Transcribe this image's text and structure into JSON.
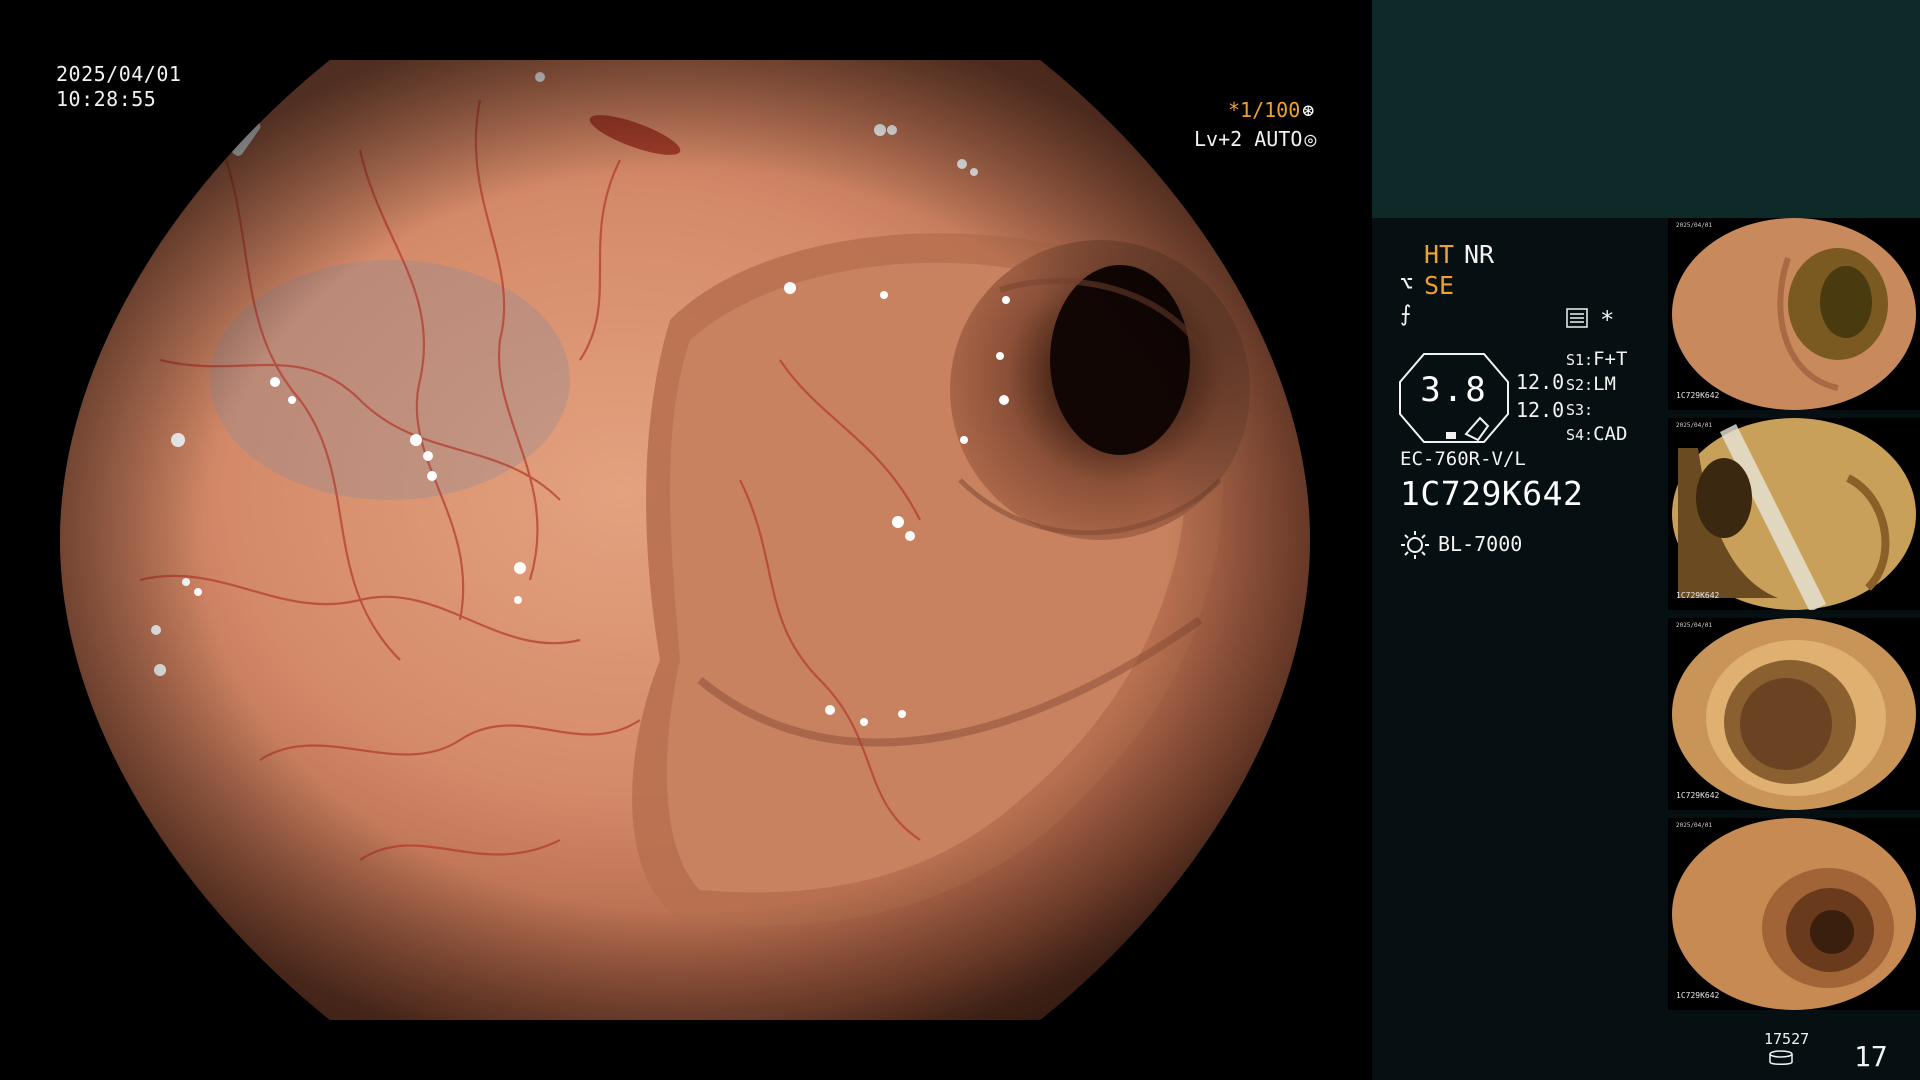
{
  "overlay": {
    "date": "2025/04/01",
    "time": "10:28:55",
    "shutter": "*1/100",
    "shutter_icon": "aperture-icon",
    "level": "Lv+2 AUTO",
    "level_icon": "iris-icon"
  },
  "sidebar": {
    "mode_ht": "HT",
    "mode_nr": "NR",
    "mode_se": "SE",
    "value_main": "3.8",
    "value_1": "12.0",
    "value_2": "12.0",
    "s_buttons": [
      {
        "key": "S1:",
        "value": "F+T"
      },
      {
        "key": "S2:",
        "value": "LM"
      },
      {
        "key": "S3:",
        "value": ""
      },
      {
        "key": "S4:",
        "value": "CAD"
      }
    ],
    "scope_model": "EC-760R-V/L",
    "scope_serial": "1C729K642",
    "light_source": "BL-7000",
    "storage_count": "17527",
    "image_count": "17"
  },
  "thumbnails": [
    {
      "label": "1C729K642",
      "date": "2025/04/01",
      "tint": "#c88a5c"
    },
    {
      "label": "1C729K642",
      "date": "2025/04/01",
      "tint": "#c9a05a"
    },
    {
      "label": "1C729K642",
      "date": "2025/04/01",
      "tint": "#c99458"
    },
    {
      "label": "1C729K642",
      "date": "2025/04/01",
      "tint": "#c78a52"
    }
  ],
  "colors": {
    "accent_orange": "#f0a030",
    "sidebar_bg": "#061012",
    "top_band": "#0e2a28"
  }
}
